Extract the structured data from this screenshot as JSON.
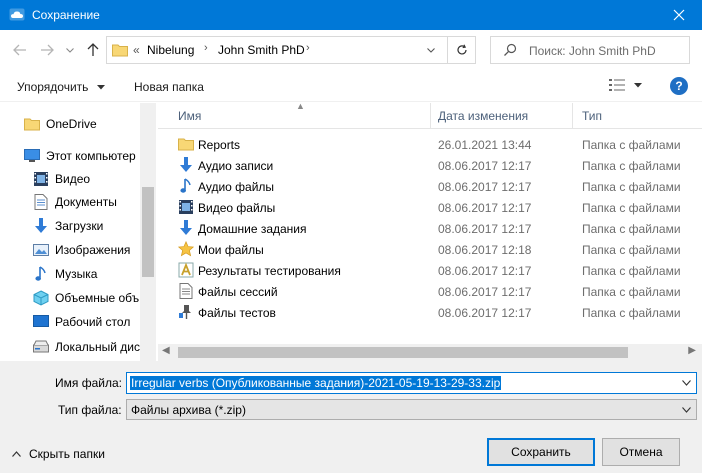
{
  "window": {
    "title": "Сохранение"
  },
  "address": {
    "overflow_glyph": "«",
    "crumbs": [
      "Nibelung",
      "John Smith PhD"
    ],
    "separator": "›"
  },
  "search": {
    "placeholder": "Поиск: John Smith PhD"
  },
  "toolbar": {
    "organize_label": "Упорядочить",
    "new_folder_label": "Новая папка",
    "help_label": "?"
  },
  "sidebar": {
    "items": [
      {
        "label": "OneDrive",
        "icon": "onedrive-folder-icon"
      },
      {
        "label": "Этот компьютер",
        "icon": "computer-icon"
      },
      {
        "label": "Видео",
        "icon": "video-icon"
      },
      {
        "label": "Документы",
        "icon": "documents-icon"
      },
      {
        "label": "Загрузки",
        "icon": "downloads-icon"
      },
      {
        "label": "Изображения",
        "icon": "pictures-icon"
      },
      {
        "label": "Музыка",
        "icon": "music-icon"
      },
      {
        "label": "Объемные объ",
        "icon": "3d-objects-icon"
      },
      {
        "label": "Рабочий стол",
        "icon": "desktop-icon"
      },
      {
        "label": "Локальный дис",
        "icon": "local-disk-icon"
      }
    ]
  },
  "columns": {
    "name": "Имя",
    "date": "Дата изменения",
    "type": "Тип"
  },
  "files": [
    {
      "name": "Reports",
      "date": "26.01.2021 13:44",
      "type": "Папка с файлами",
      "icon": "folder-icon"
    },
    {
      "name": "Аудио записи",
      "date": "08.06.2017 12:17",
      "type": "Папка с файлами",
      "icon": "downloads-folder-icon"
    },
    {
      "name": "Аудио файлы",
      "date": "08.06.2017 12:17",
      "type": "Папка с файлами",
      "icon": "music-folder-icon"
    },
    {
      "name": "Видео файлы",
      "date": "08.06.2017 12:17",
      "type": "Папка с файлами",
      "icon": "video-folder-icon"
    },
    {
      "name": "Домашние задания",
      "date": "08.06.2017 12:17",
      "type": "Папка с файлами",
      "icon": "downloads-folder-icon"
    },
    {
      "name": "Мои файлы",
      "date": "08.06.2017 12:18",
      "type": "Папка с файлами",
      "icon": "favorites-star-icon"
    },
    {
      "name": "Результаты тестирования",
      "date": "08.06.2017 12:17",
      "type": "Папка с файлами",
      "icon": "results-folder-icon"
    },
    {
      "name": "Файлы сессий",
      "date": "08.06.2017 12:17",
      "type": "Папка с файлами",
      "icon": "document-folder-icon"
    },
    {
      "name": "Файлы тестов",
      "date": "08.06.2017 12:17",
      "type": "Папка с файлами",
      "icon": "pin-folder-icon"
    }
  ],
  "form": {
    "filename_label": "Имя файла:",
    "filename_value": "Irregular verbs (Опубликованные задания)-2021-05-19-13-29-33.zip",
    "filetype_label": "Тип файла:",
    "filetype_value": "Файлы архива (*.zip)"
  },
  "footer": {
    "hide_folders_label": "Скрыть папки",
    "save_label": "Сохранить",
    "cancel_label": "Отмена"
  },
  "colors": {
    "accent": "#0078d7",
    "folder": "#f8d775"
  }
}
